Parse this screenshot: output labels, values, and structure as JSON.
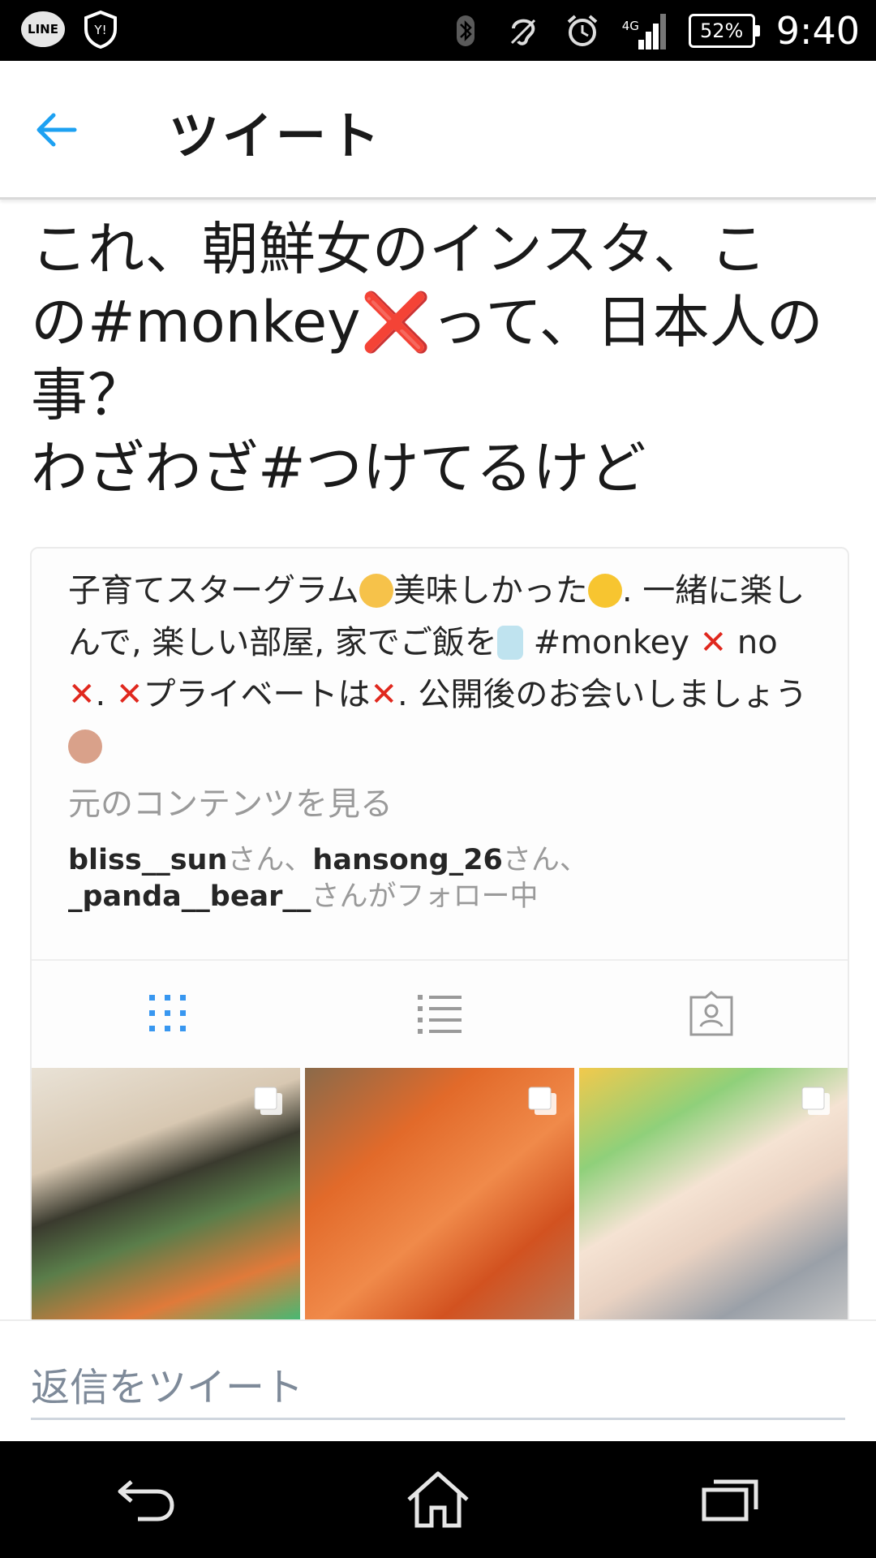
{
  "status_bar": {
    "left_icons": [
      "line-app-icon",
      "yahoo-shield-icon"
    ],
    "line_label": "LINE",
    "right_icons": [
      "bluetooth-icon",
      "accessibility-icon",
      "alarm-icon",
      "signal-icon",
      "battery-icon"
    ],
    "network_type": "4G",
    "battery_level": "52%",
    "time": "9:40"
  },
  "app_bar": {
    "back_icon": "arrow-left-icon",
    "title": "ツイート",
    "accent_color": "#1da1f2"
  },
  "tweet": {
    "line1": "これ、朝鮮女のインスタ、こ",
    "line2_a": "の#monkey",
    "line2_mark": "❌",
    "line2_b": "って、日本人の",
    "line3": "事？",
    "line4": "わざわざ#つけてるけど"
  },
  "embedded_card": {
    "bio": {
      "part1": "子育てスターグラム",
      "part2": "美味しかった",
      "part3": ". 一緒に楽しんで, 楽しい部屋, 家でご飯を",
      "part4": " #monkey ",
      "x1": "✕",
      "part5": " no ",
      "x2": "✕",
      "part6": ". ",
      "x3": "✕",
      "part7": "プライベートは",
      "x4": "✕",
      "part8": ". 公開後のお会いしましょう",
      "emoji_icons": [
        "laughing-emoji-icon",
        "smile-emoji-icon",
        "baby-bottle-emoji-icon",
        "girl-raising-hand-emoji-icon"
      ]
    },
    "see_original": "元のコンテンツを見る",
    "followers": {
      "user1": "bliss__sun",
      "suffix1": "さん、",
      "user2": "hansong_26",
      "suffix2": "さん、",
      "user3": "_panda__bear__",
      "suffix3": "さんがフォロー中"
    },
    "tabs": [
      {
        "icon": "grid-view-icon",
        "active": true
      },
      {
        "icon": "list-view-icon",
        "active": false
      },
      {
        "icon": "tagged-person-icon",
        "active": false
      }
    ],
    "photos": [
      {
        "desc_icon": "multiple-photos-icon"
      },
      {
        "desc_icon": "multiple-photos-icon"
      },
      {
        "desc_icon": "multiple-photos-icon"
      }
    ]
  },
  "reply": {
    "placeholder": "返信をツイート"
  },
  "nav_bar": {
    "buttons": [
      "back-nav-icon",
      "home-icon",
      "recent-apps-icon"
    ]
  }
}
